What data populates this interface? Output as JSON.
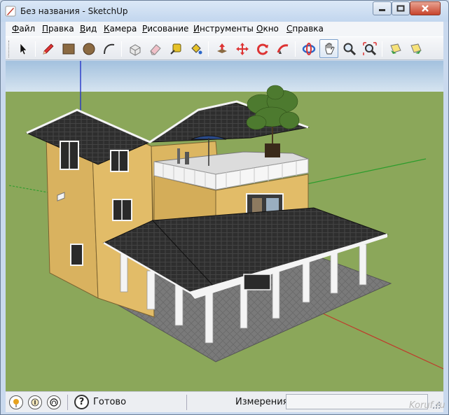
{
  "window": {
    "title": "Без названия - SketchUp"
  },
  "menu": {
    "items": [
      {
        "label": "Файл",
        "key": "Ф",
        "rest": "айл"
      },
      {
        "label": "Правка",
        "key": "П",
        "rest": "равка"
      },
      {
        "label": "Вид",
        "key": "В",
        "rest": "ид"
      },
      {
        "label": "Камера",
        "key": "К",
        "rest": "амера"
      },
      {
        "label": "Рисование",
        "key": "Р",
        "rest": "исование"
      },
      {
        "label": "Инструменты",
        "key": "И",
        "rest": "нструменты"
      },
      {
        "label": "Окно",
        "key": "О",
        "rest": "кно"
      },
      {
        "label": "Справка",
        "key": "С",
        "rest": "правка"
      }
    ]
  },
  "toolbar": {
    "tools": [
      "select-icon",
      "pencil-icon",
      "rectangle-icon",
      "circle-icon",
      "arc-icon",
      "make-component-icon",
      "eraser-icon",
      "tape-measure-icon",
      "paint-bucket-icon",
      "push-pull-icon",
      "move-icon",
      "rotate-icon",
      "follow-me-icon",
      "orbit-icon",
      "pan-icon",
      "zoom-icon",
      "zoom-extents-icon",
      "previous-view-icon",
      "next-view-icon"
    ],
    "active_tool": "pan-icon"
  },
  "status": {
    "text": "Готово",
    "measurements_label": "Измерения",
    "measurements_value": "",
    "watermark": "Koruf.ru"
  },
  "colors": {
    "sky": "#a9c6e0",
    "ground": "#8ba75a",
    "wall": "#d9b25f",
    "roof": "#2f2f2f",
    "trim": "#f4f4f4",
    "foundation": "#7d7d7d"
  }
}
